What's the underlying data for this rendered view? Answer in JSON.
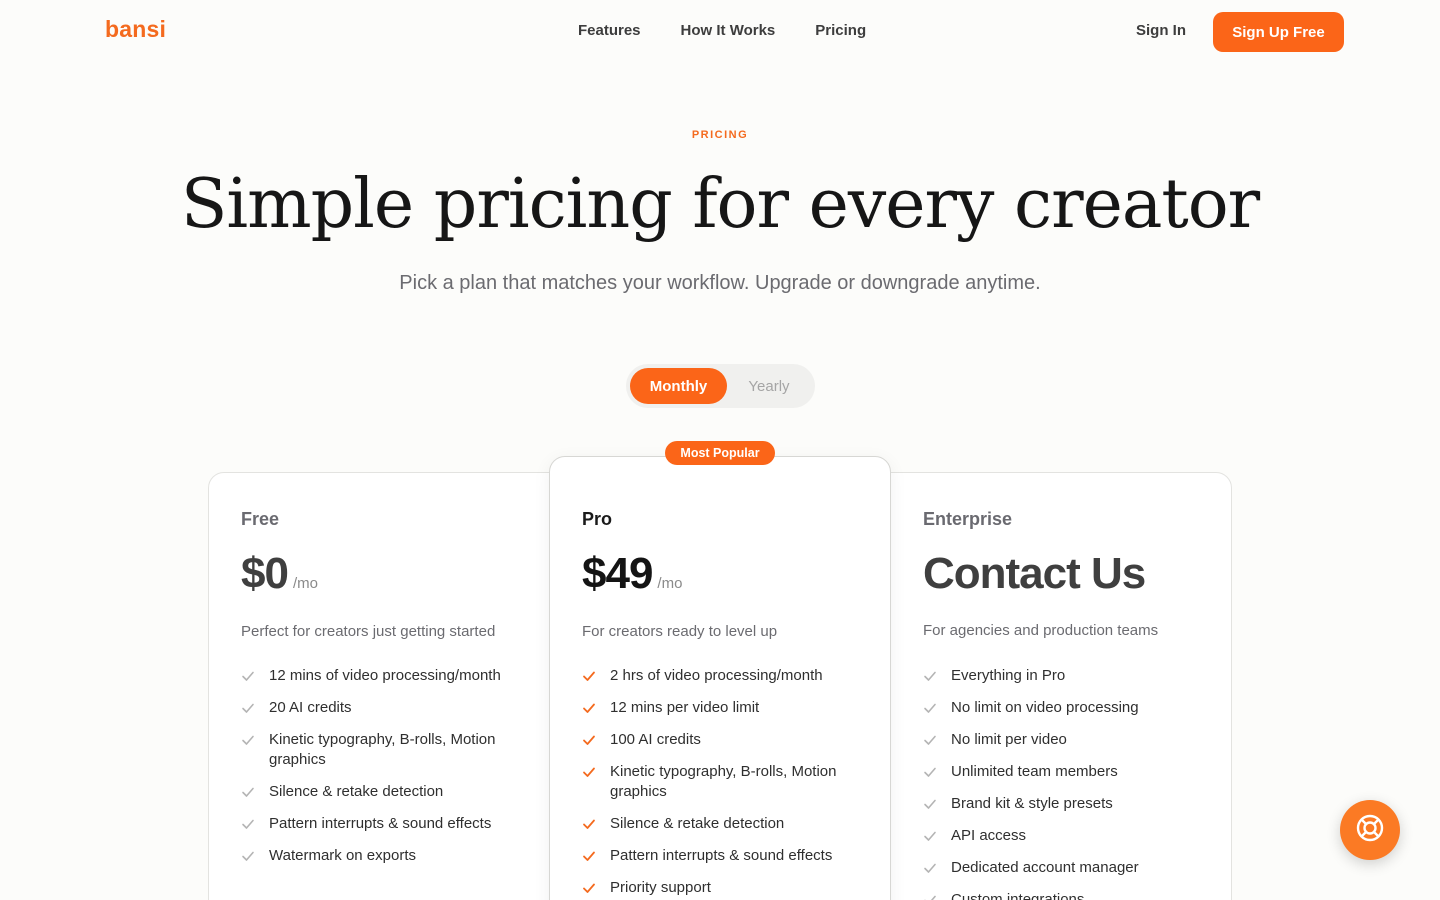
{
  "brand": {
    "logo": "bansi",
    "accent": "#fb6518"
  },
  "nav": {
    "links": [
      "Features",
      "How It Works",
      "Pricing"
    ],
    "sign_in": "Sign In",
    "sign_up": "Sign Up Free"
  },
  "hero": {
    "eyebrow": "PRICING",
    "title": "Simple pricing for every creator",
    "subtitle": "Pick a plan that matches your workflow. Upgrade or downgrade anytime."
  },
  "billing_toggle": {
    "options": [
      "Monthly",
      "Yearly"
    ],
    "selected": "Monthly"
  },
  "plans": [
    {
      "name": "Free",
      "price": "$0",
      "period": "/mo",
      "description": "Perfect for creators just getting started",
      "check_icon": "check-icon",
      "features": [
        "12 mins of video processing/month",
        "20 AI credits",
        "Kinetic typography, B-rolls, Motion graphics",
        "Silence & retake detection",
        "Pattern interrupts & sound effects",
        "Watermark on exports"
      ]
    },
    {
      "name": "Pro",
      "badge": "Most Popular",
      "price": "$49",
      "period": "/mo",
      "description": "For creators ready to level up",
      "check_icon": "check-icon",
      "features": [
        "2 hrs of video processing/month",
        "12 mins per video limit",
        "100 AI credits",
        "Kinetic typography, B-rolls, Motion graphics",
        "Silence & retake detection",
        "Pattern interrupts & sound effects",
        "Priority support"
      ]
    },
    {
      "name": "Enterprise",
      "price": "Contact Us",
      "description": "For agencies and production teams",
      "check_icon": "check-icon",
      "features": [
        "Everything in Pro",
        "No limit on video processing",
        "No limit per video",
        "Unlimited team members",
        "Brand kit & style presets",
        "API access",
        "Dedicated account manager",
        "Custom integrations"
      ]
    }
  ],
  "help_widget": {
    "icon": "lifebuoy-icon"
  }
}
